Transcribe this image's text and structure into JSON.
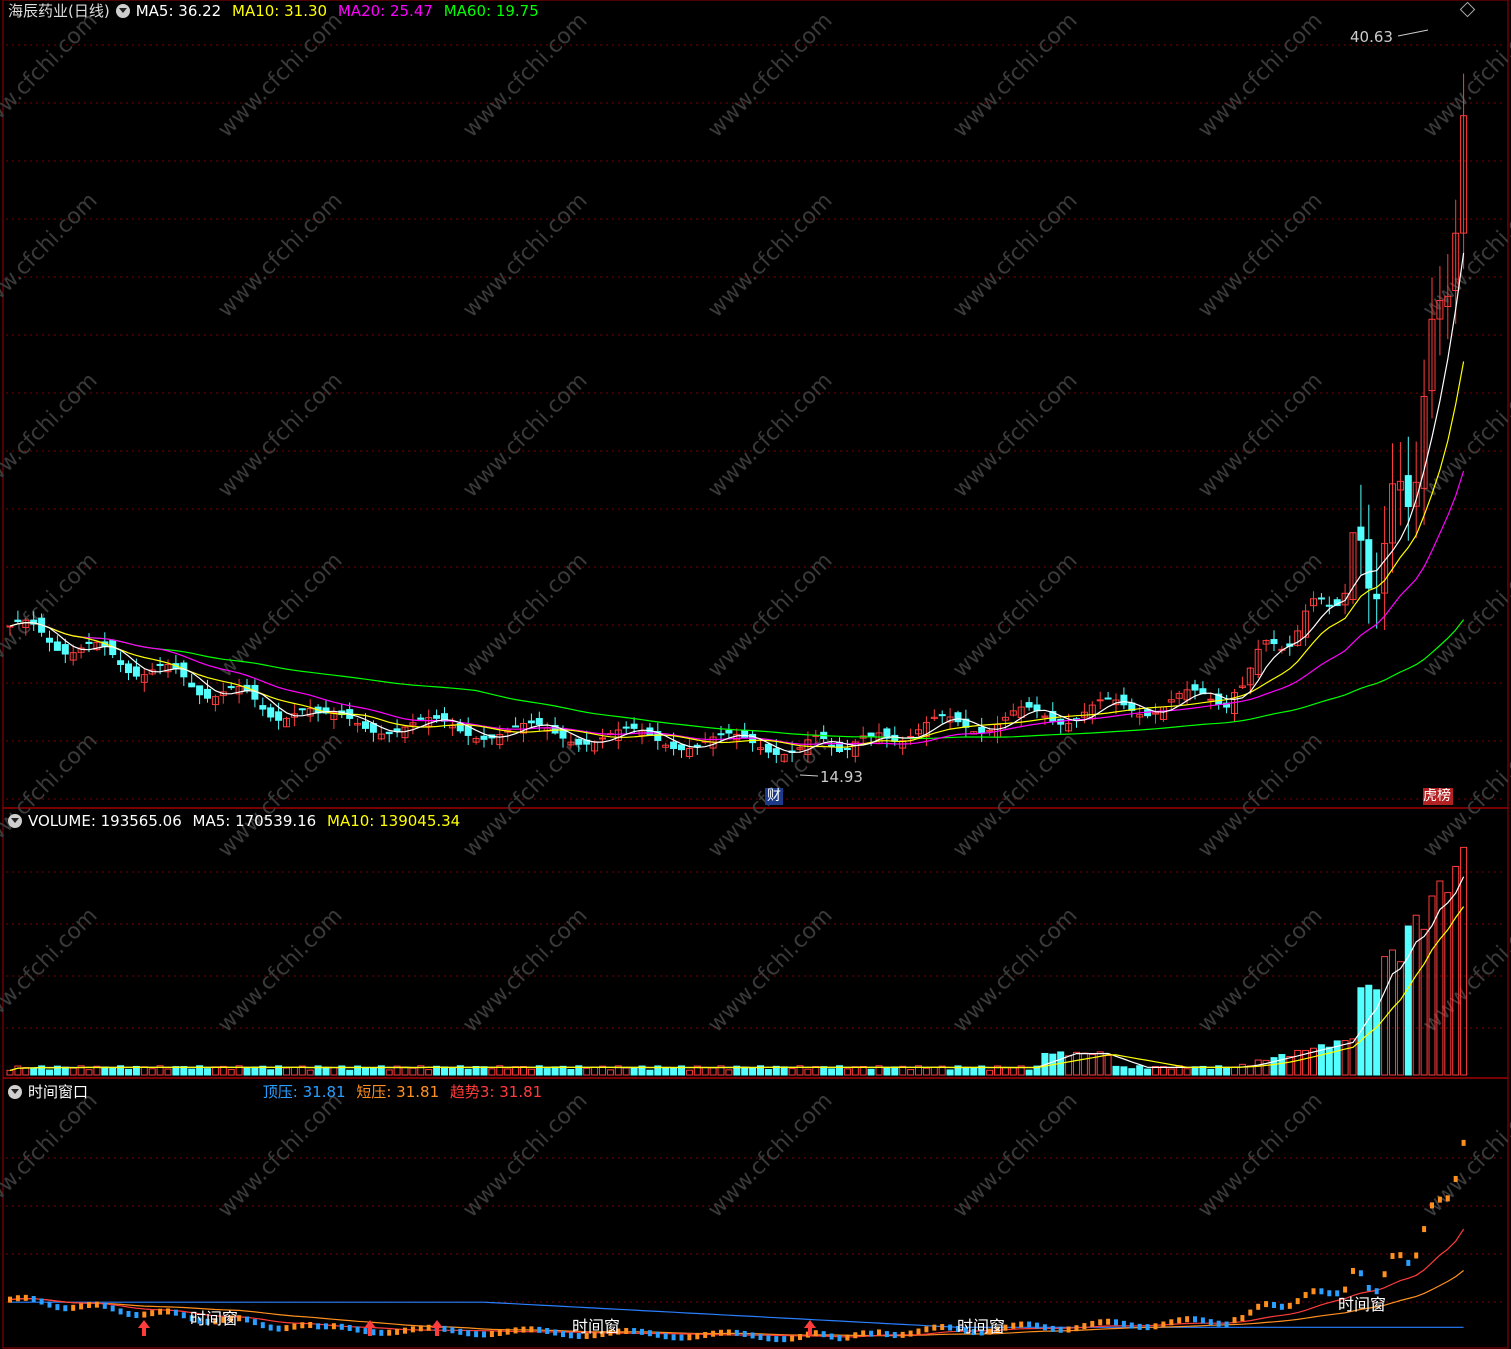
{
  "price_panel": {
    "title": "海辰药业(日线)",
    "ma5": "MA5: 36.22",
    "ma10": "MA10: 31.30",
    "ma20": "MA20: 25.47",
    "ma60": "MA60: 19.75",
    "high_label": "40.63",
    "low_label": "14.93",
    "marker_cai": "财",
    "marker_bang": "龙虎榜"
  },
  "volume_panel": {
    "volume": "VOLUME: 193565.06",
    "ma5": "MA5: 170539.16",
    "ma10": "MA10: 139045.34"
  },
  "indicator_panel": {
    "title": "时间窗口",
    "top_pressure": "顶压: 31.81",
    "short_pressure": "短压: 31.81",
    "trend": "趋势3: 31.81",
    "window_label": "时间窗"
  },
  "colors": {
    "up": "#ff3c3c",
    "down": "#54ffff",
    "ma5": "#ffffff",
    "ma10": "#ffff00",
    "ma20": "#ff00ff",
    "ma60": "#00ff00",
    "grid": "#7a0000",
    "border": "#a00000",
    "cai_bg": "#1d3b8a",
    "bang_bg": "#b22222",
    "window_orange": "#ff9020",
    "pressure_blue": "#2a7fff"
  },
  "watermark": "www.cfchi.com"
}
